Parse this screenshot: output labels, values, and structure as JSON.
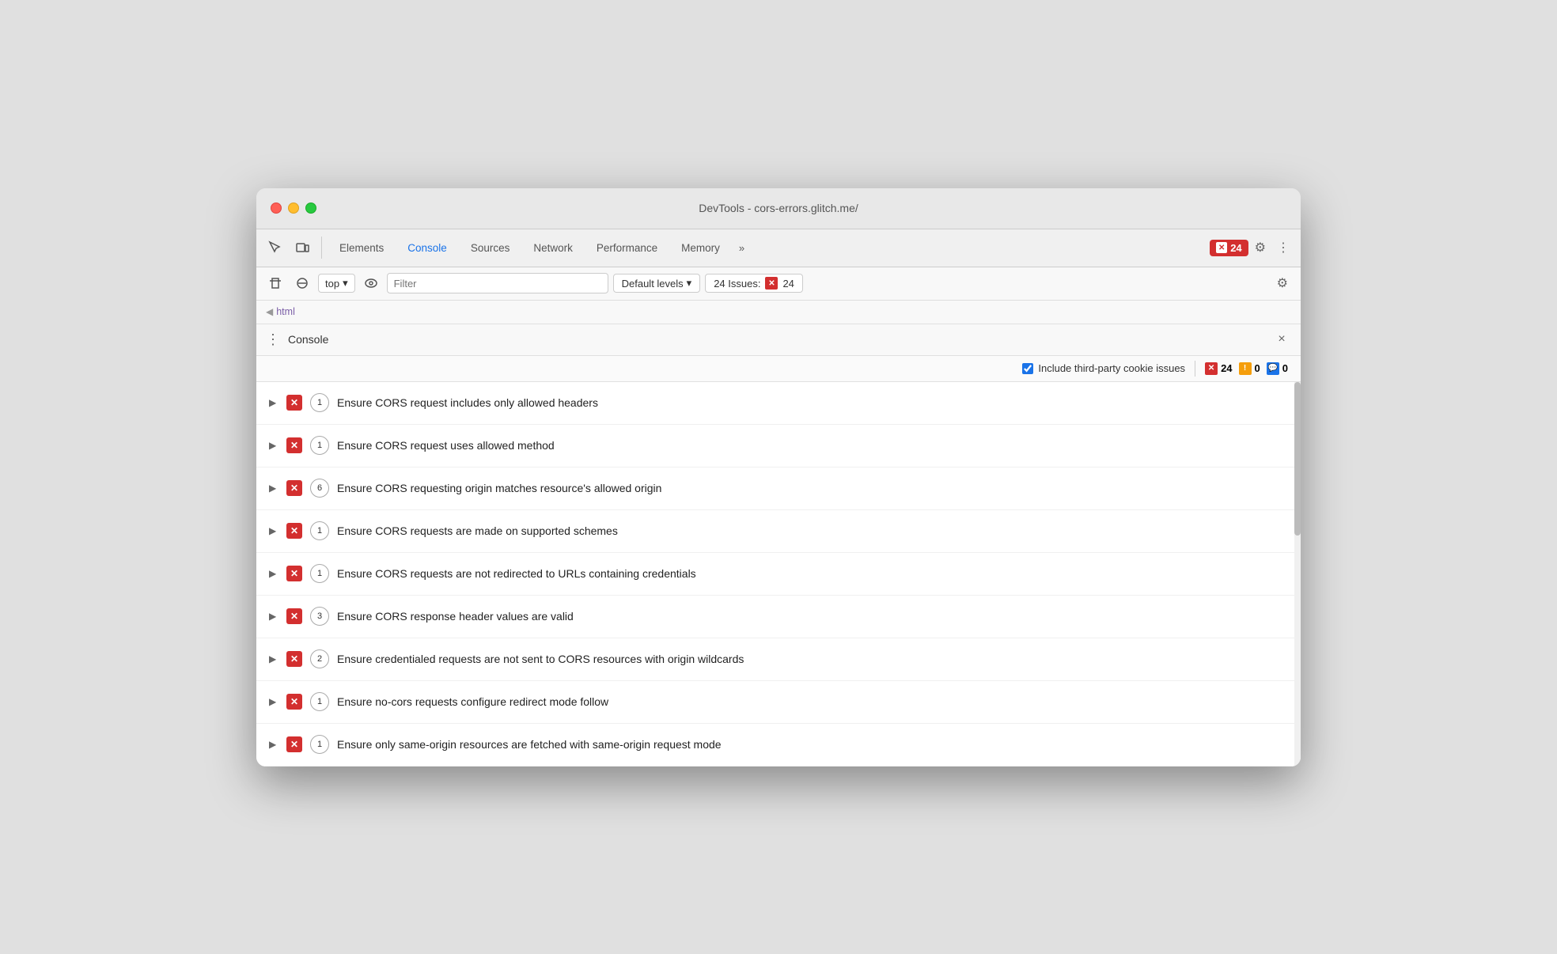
{
  "window": {
    "title": "DevTools - cors-errors.glitch.me/"
  },
  "toolbar": {
    "tabs": [
      {
        "id": "elements",
        "label": "Elements",
        "active": false
      },
      {
        "id": "console",
        "label": "Console",
        "active": true
      },
      {
        "id": "sources",
        "label": "Sources",
        "active": false
      },
      {
        "id": "network",
        "label": "Network",
        "active": false
      },
      {
        "id": "performance",
        "label": "Performance",
        "active": false
      },
      {
        "id": "memory",
        "label": "Memory",
        "active": false
      }
    ],
    "more_label": "»",
    "error_count": "24",
    "gear_icon": "⚙",
    "more_icon": "⋮"
  },
  "console_toolbar": {
    "context": "top",
    "filter_placeholder": "Filter",
    "levels_label": "Default levels",
    "issues_label": "24 Issues:",
    "issues_count": "24"
  },
  "breadcrumb": {
    "arrow": "◀",
    "text": "html"
  },
  "panel": {
    "title": "Console",
    "close_label": "×"
  },
  "issues_bar": {
    "checkbox_label": "Include third-party cookie issues",
    "error_count": "24",
    "warning_count": "0",
    "info_count": "0"
  },
  "issues": [
    {
      "text": "Ensure CORS request includes only allowed headers",
      "count": "1"
    },
    {
      "text": "Ensure CORS request uses allowed method",
      "count": "1"
    },
    {
      "text": "Ensure CORS requesting origin matches resource's allowed origin",
      "count": "6"
    },
    {
      "text": "Ensure CORS requests are made on supported schemes",
      "count": "1"
    },
    {
      "text": "Ensure CORS requests are not redirected to URLs containing credentials",
      "count": "1"
    },
    {
      "text": "Ensure CORS response header values are valid",
      "count": "3"
    },
    {
      "text": "Ensure credentialed requests are not sent to CORS resources with origin wildcards",
      "count": "2"
    },
    {
      "text": "Ensure no-cors requests configure redirect mode follow",
      "count": "1"
    },
    {
      "text": "Ensure only same-origin resources are fetched with same-origin request mode",
      "count": "1"
    }
  ]
}
